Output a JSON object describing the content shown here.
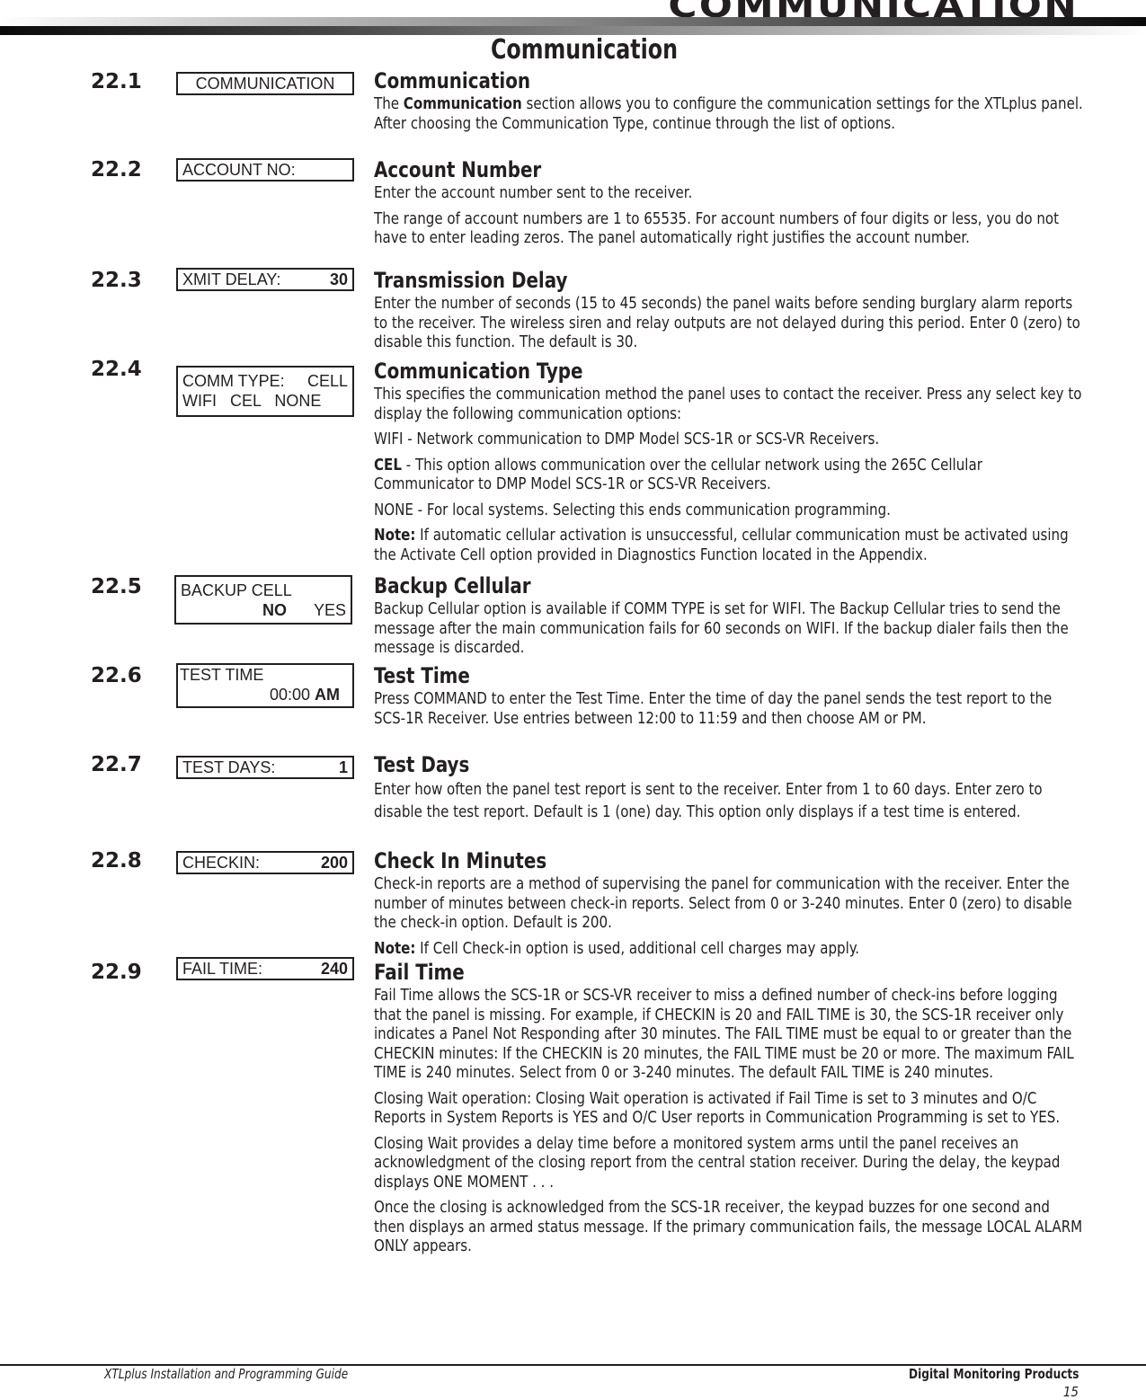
{
  "header": {
    "section_title": "COMMUNICATION"
  },
  "page_title": "Communication",
  "sections": [
    {
      "number": "22.1",
      "display": {
        "lines": [
          {
            "left": "COMMUNICATION",
            "right": ""
          }
        ]
      },
      "title": "Communication",
      "paragraphs": [
        {
          "bold_prefix": "",
          "text": "The ",
          "bold_inline": "Communication",
          "text_after": " section allows you to configure the communication settings for the XTLplus panel. After choosing the Communication Type, continue through the list of options."
        }
      ]
    },
    {
      "number": "22.2",
      "display": {
        "lines": [
          {
            "left": "ACCOUNT NO:",
            "right": ""
          }
        ]
      },
      "title": "Account Number",
      "paragraphs": [
        {
          "text": "Enter the account number sent to the receiver."
        },
        {
          "text": "The range of account numbers are 1 to 65535. For account numbers of four digits or less, you do not have to enter leading zeros. The panel automatically right justifies the account number."
        }
      ]
    },
    {
      "number": "22.3",
      "display": {
        "lines": [
          {
            "left": "XMIT DELAY:",
            "right": "30"
          }
        ]
      },
      "title": "Transmission Delay",
      "paragraphs": [
        {
          "text": "Enter the number of seconds (15 to 45 seconds) the panel waits before sending burglary alarm reports to the receiver. The wireless siren and relay outputs are not delayed during this period. Enter 0 (zero) to disable this function. The default is 30."
        }
      ]
    },
    {
      "number": "22.4",
      "display": {
        "lines": [
          {
            "left": "COMM TYPE:",
            "right": "CELL"
          },
          {
            "left": "WIFI   CEL   NONE",
            "right": ""
          }
        ]
      },
      "title": "Communication Type",
      "paragraphs": [
        {
          "text": "This specifies the communication method the panel uses to contact the receiver. Press any select key to display the following communication options:"
        },
        {
          "text": "WIFI - Network communication to DMP Model SCS-1R or SCS-VR Receivers."
        },
        {
          "bold_prefix": "CEL",
          "text": " - This option allows communication over the cellular network using the 265C Cellular Communicator to DMP Model SCS-1R or SCS-VR Receivers."
        },
        {
          "text": "NONE - For local systems. Selecting this ends communication programming."
        },
        {
          "bold_prefix": "Note:",
          "text": " If automatic cellular activation is unsuccessful, cellular communication must be activated using the Activate Cell option provided in Diagnostics Function located in the Appendix."
        }
      ]
    },
    {
      "number": "22.5",
      "display": {
        "lines": [
          {
            "left": "BACKUP CELL",
            "right": ""
          },
          {
            "left": "",
            "right_bold": "NO",
            "right": "YES"
          }
        ]
      },
      "title": "Backup Cellular",
      "paragraphs": [
        {
          "text": "Backup Cellular option is available if COMM TYPE is set for WIFI. The Backup Cellular tries to send the message after the main communication fails for 60 seconds on WIFI. If the backup dialer fails then the message is discarded."
        }
      ]
    },
    {
      "number": "22.6",
      "display": {
        "lines": [
          {
            "left": "TEST TIME",
            "right": ""
          },
          {
            "left": "",
            "right": "00:00",
            "right_bold": "AM"
          }
        ]
      },
      "title": "Test Time",
      "paragraphs": [
        {
          "text": "Press COMMAND to enter the Test Time. Enter the time of day the panel sends the test report to the SCS-1R Receiver. Use entries between 12:00 to 11:59 and then choose AM or PM."
        }
      ]
    },
    {
      "number": "22.7",
      "display": {
        "lines": [
          {
            "left": "TEST DAYS:",
            "right": "1"
          }
        ]
      },
      "title": "Test Days",
      "paragraphs": [
        {
          "text": "Enter how often the panel test report is sent to the receiver. Enter from 1 to 60 days. Enter zero to disable the test report. Default is 1 (one) day. This option only displays if a test time is entered."
        }
      ]
    },
    {
      "number": "22.8",
      "display": {
        "lines": [
          {
            "left": "CHECKIN:",
            "right": "200"
          }
        ]
      },
      "title": "Check In Minutes",
      "paragraphs": [
        {
          "text": "Check-in reports are a method of supervising the panel for communication with the receiver. Enter the number of minutes between check-in reports. Select from 0 or 3-240 minutes. Enter 0 (zero) to disable the check-in option. Default is 200."
        },
        {
          "bold_prefix": "Note:",
          "text": " If Cell Check-in option is used, additional cell charges may apply."
        }
      ]
    },
    {
      "number": "22.9",
      "display": {
        "lines": [
          {
            "left": "FAIL TIME:",
            "right": "240"
          }
        ]
      },
      "title": "Fail Time",
      "paragraphs": [
        {
          "text": "Fail Time allows the SCS-1R or SCS-VR receiver to miss a defined number of check-ins before logging that the panel is missing. For example, if CHECKIN is 20 and FAIL TIME is 30, the SCS-1R receiver only indicates a Panel Not Responding after 30 minutes. The FAIL TIME must be equal to or greater than the CHECKIN minutes: If the CHECKIN is 20 minutes, the FAIL TIME must be 20 or more. The maximum FAIL TIME is 240 minutes. Select from 0 or 3-240 minutes. The default FAIL TIME is 240 minutes."
        },
        {
          "text": "Closing Wait operation: Closing Wait operation is activated if Fail Time is set to 3 minutes and O/C Reports in System Reports is YES and O/C User reports in Communication Programming is set to YES."
        },
        {
          "text": "Closing Wait provides a delay time before a monitored system arms until the panel receives an acknowledgment of the closing report from the central station receiver. During the delay, the keypad displays ONE MOMENT .  .  ."
        },
        {
          "text": "Once the closing is acknowledged from the SCS-1R receiver, the keypad buzzes for one second and then displays an armed status message. If the primary communication fails, the message LOCAL ALARM ONLY appears."
        }
      ]
    }
  ],
  "footer": {
    "guide_title": "XTLplus Installation and Programming Guide",
    "company": "Digital Monitoring Products",
    "page_number": "15"
  }
}
